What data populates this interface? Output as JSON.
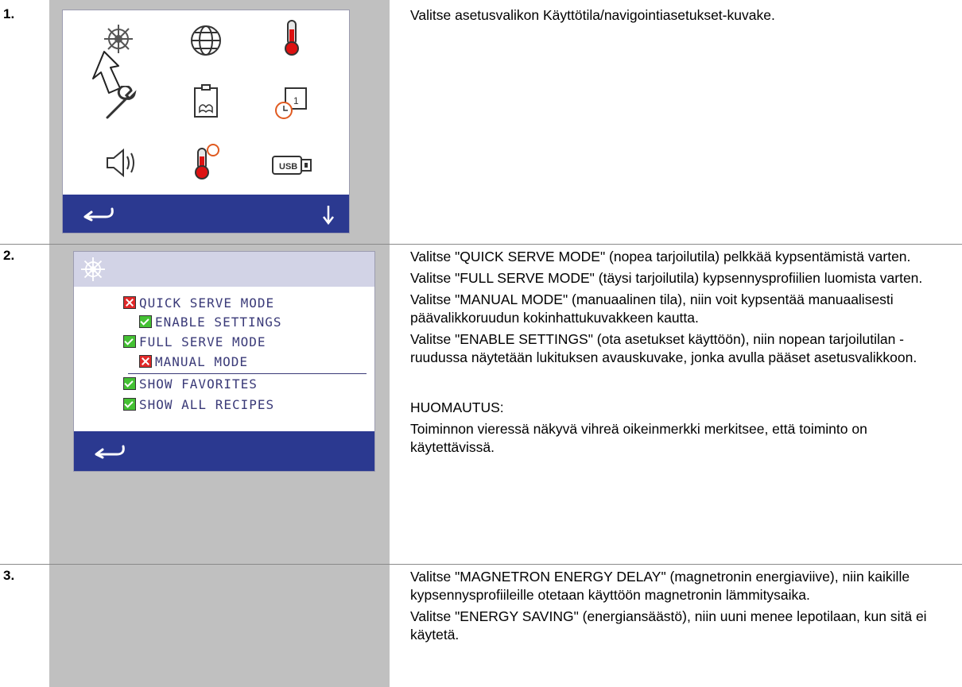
{
  "steps": [
    {
      "number": "1.",
      "text": [
        "Valitse asetusvalikon Käyttötila/navigointiasetukset-kuvake."
      ],
      "icons": [
        "settings-wheel-icon",
        "globe-icon",
        "thermometer-icon",
        "wrench-icon",
        "manual-book-icon",
        "calendar-clock-icon",
        "speaker-icon",
        "thermometer-clock-icon",
        "usb-icon"
      ],
      "usb_label": "USB"
    },
    {
      "number": "2.",
      "text": [
        "Valitse \"QUICK SERVE MODE\" (nopea tarjoilutila) pelkkää kypsentämistä varten.",
        "Valitse \"FULL SERVE MODE\" (täysi tarjoilutila) kypsennysprofiilien luomista varten.",
        "Valitse \"MANUAL MODE\" (manuaalinen tila), niin voit kypsentää manuaalisesti päävalikkoruudun kokinhattukuvakkeen kautta.",
        "Valitse \"ENABLE SETTINGS\" (ota asetukset käyttöön), niin nopean tarjoilutilan -ruudussa näytetään lukituksen avauskuvake, jonka avulla pääset asetusvalikkoon."
      ],
      "note_title": "HUOMAUTUS:",
      "note_text": "Toiminnon vieressä näkyvä vihreä oikeinmerkki merkitsee, että toiminto on käytettävissä.",
      "options": [
        {
          "label": "QUICK SERVE MODE",
          "state": "off"
        },
        {
          "label": "ENABLE SETTINGS",
          "state": "on"
        },
        {
          "label": "FULL SERVE MODE",
          "state": "on"
        },
        {
          "label": "MANUAL MODE",
          "state": "off"
        },
        {
          "label": "SHOW FAVORITES",
          "state": "on"
        },
        {
          "label": "SHOW ALL RECIPES",
          "state": "on"
        }
      ]
    },
    {
      "number": "3.",
      "text": [
        "Valitse \"MAGNETRON ENERGY DELAY\" (magnetronin energiaviive), niin kaikille kypsennysprofiileille otetaan käyttöön magnetronin lämmitysaika.",
        "Valitse \"ENERGY SAVING\" (energiansäästö), niin uuni menee lepotilaan, kun sitä ei käytetä."
      ]
    }
  ],
  "colors": {
    "bar": "#2b3990",
    "panel": "#c0c0c0",
    "check_on": "#44c133",
    "check_off": "#e02828"
  }
}
